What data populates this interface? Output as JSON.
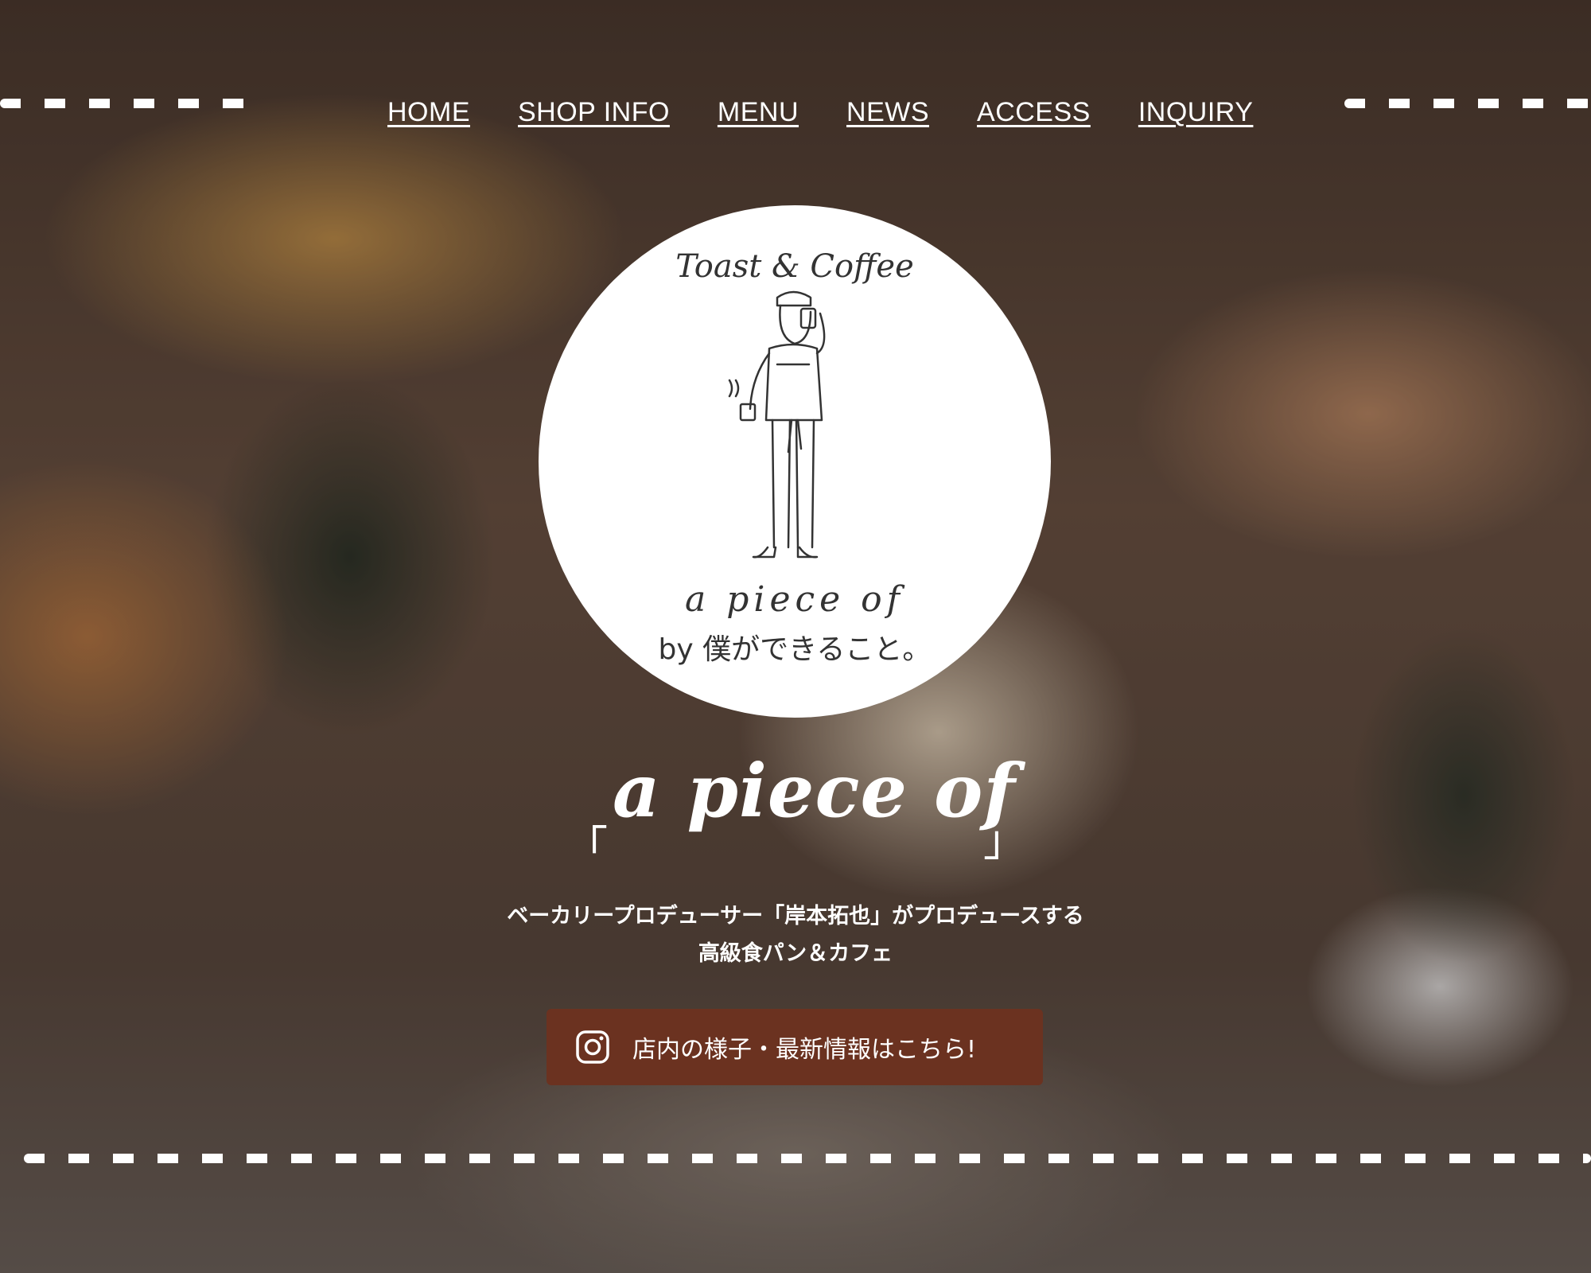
{
  "nav": {
    "items": [
      {
        "label": "HOME"
      },
      {
        "label": "SHOP INFO"
      },
      {
        "label": "MENU"
      },
      {
        "label": "NEWS"
      },
      {
        "label": "ACCESS"
      },
      {
        "label": "INQUIRY"
      }
    ]
  },
  "logo": {
    "top_text": "Toast & Coffee",
    "name_text": "a piece of",
    "sub_text": "by 僕ができること。"
  },
  "tagline": {
    "open_bracket": "「",
    "script": "a piece of",
    "close_bracket": "」"
  },
  "description": {
    "line1": "ベーカリープロデューサー「岸本拓也」がプロデュースする",
    "line2": "高級食パン＆カフェ"
  },
  "instagram_button": {
    "icon": "instagram-icon",
    "label": "店内の様子・最新情報はこちら!"
  },
  "colors": {
    "button_bg": "#6b3220",
    "text": "#ffffff",
    "logo_bg": "#ffffff",
    "line_art": "#333333"
  }
}
